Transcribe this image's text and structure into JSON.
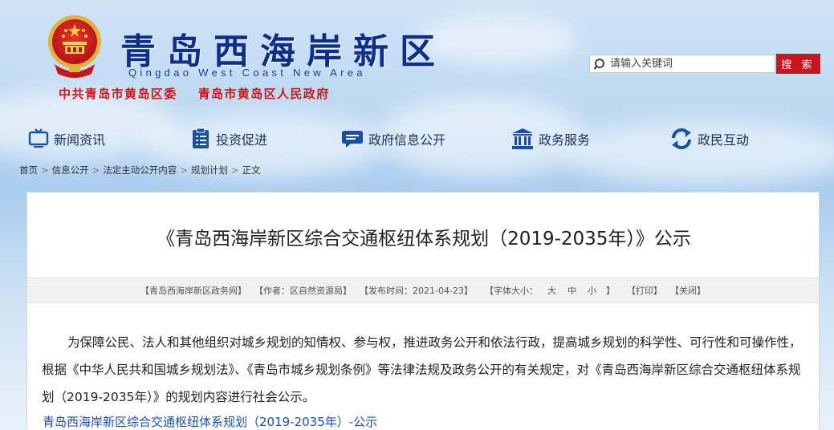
{
  "header": {
    "title": "青岛西海岸新区",
    "title_en": "Qingdao West Coast New Area",
    "sub_left": "中共青岛市黄岛区委",
    "sub_right": "青岛市黄岛区人民政府"
  },
  "search": {
    "placeholder": "请输入关键词",
    "button_label": "搜 索"
  },
  "nav": {
    "items": [
      {
        "label": "新闻资讯",
        "icon": "monitor-icon"
      },
      {
        "label": "投资促进",
        "icon": "document-list-icon"
      },
      {
        "label": "政府信息公开",
        "icon": "chat-bubble-icon"
      },
      {
        "label": "政务服务",
        "icon": "building-icon"
      },
      {
        "label": "政民互动",
        "icon": "refresh-cycle-icon"
      }
    ]
  },
  "breadcrumb": [
    "首页",
    "信息公开",
    "法定主动公开内容",
    "规划计划",
    "正文"
  ],
  "article": {
    "title": "《青岛西海岸新区综合交通枢纽体系规划（2019-2035年）》公示",
    "meta": {
      "source": "【青岛西海岸新区政务网】",
      "author": "【作者：区自然资源局】",
      "date": "【发布时间：2021-04-23】",
      "font_size_label": "【字体大小：",
      "font_large": "大",
      "font_medium": "中",
      "font_small": "小",
      "font_size_end": "】",
      "print": "【打印】",
      "close": "【关闭】"
    },
    "body": "为保障公民、法人和其他组织对城乡规划的知情权、参与权，推进政务公开和依法行政，提高城乡规划的科学性、可行性和可操作性，根据《中华人民共和国城乡规划法》、《青岛市城乡规划条例》等法律法规及政务公开的有关规定，对《青岛西海岸新区综合交通枢纽体系规划（2019-2035年）》的规划内容进行社会公示。",
    "attachment": "青岛西海岸新区综合交通枢纽体系规划（2019-2035年）-公示"
  },
  "colors": {
    "title_blue": "#0d2f8a",
    "sub_red": "#c81a1a",
    "search_button": "#c9151e",
    "link_blue": "#1a4fb0"
  }
}
